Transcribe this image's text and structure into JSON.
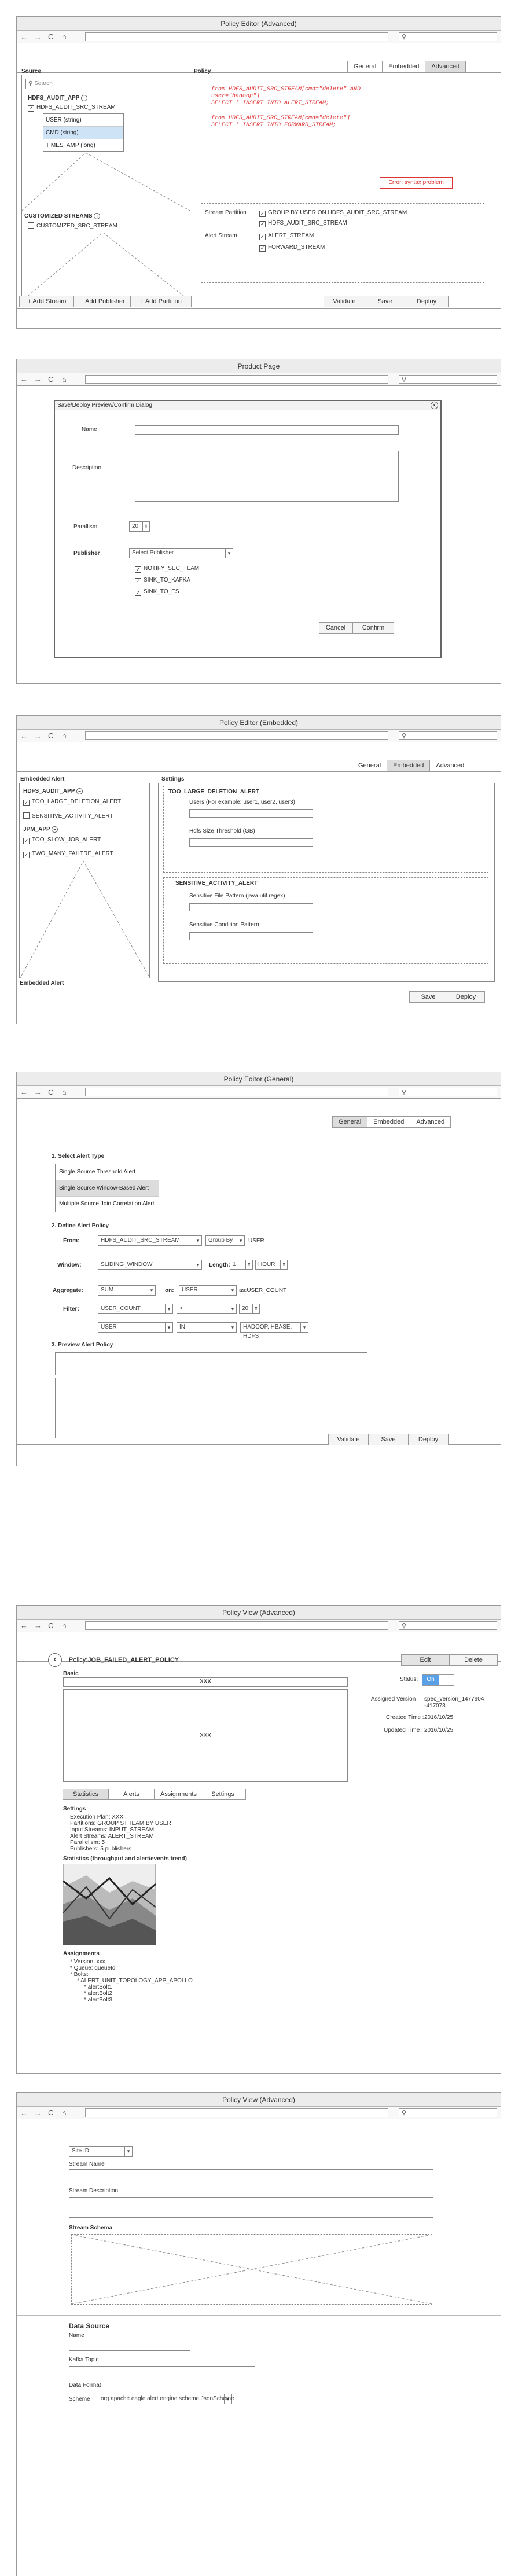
{
  "shared": {
    "nav": {
      "back": "←",
      "forward": "→",
      "reload": "C",
      "home": "⌂"
    },
    "search_icon": "⚲"
  },
  "w1": {
    "title": "Policy Editor (Advanced)",
    "tabs": [
      "General",
      "Embedded",
      "Advanced"
    ],
    "source_label": "Source",
    "policy_label": "Policy",
    "search_placeholder": "Search",
    "stream": "HDFS_AUDIT_APP",
    "stream_item": "HDFS_AUDIT_SRC_STREAM",
    "fields": [
      "USER (string)",
      "CMD (string)",
      "TIMESTAMP (long)"
    ],
    "custom_streams": "CUSTOMIZED STREAMS",
    "custom_item": "CUSTOMIZED_SRC_STREAM",
    "code": [
      "from HDFS_AUDIT_SRC_STREAM[cmd=\"delete\" AND",
      "user=\"hadoop\"]",
      "SELECT * INSERT INTO ALERT_STREAM;",
      "",
      "from HDFS_AUDIT_SRC_STREAM[cmd=\"delete\"]",
      "SELECT * INSERT INTO FORWARD_STREAM;"
    ],
    "error": "Error: syntax problem",
    "stream_partition": "Stream Partition",
    "alert_stream": "Alert Stream",
    "partitions": [
      "GROUP BY USER ON HDFS_AUDIT_SRC_STREAM",
      "HDFS_AUDIT_SRC_STREAM"
    ],
    "alert_streams": [
      "ALERT_STREAM",
      "FORWARD_STREAM"
    ],
    "buttons": [
      "+ Add Stream",
      "+ Add Publisher",
      "+ Add Partition"
    ],
    "actions": [
      "Validate",
      "Save",
      "Deploy"
    ]
  },
  "w2": {
    "title": "Product Page",
    "dialog_title": "Save/Deploy Preview/Confirm Dialog",
    "close": "✕",
    "name": "Name",
    "description": "Description",
    "parallism": "Parallism",
    "parallism_value": "20",
    "publisher": "Publisher",
    "publisher_placeholder": "Select Publisher",
    "publishers": [
      "NOTIFY_SEC_TEAM",
      "SINK_TO_KAFKA",
      "SINK_TO_ES"
    ],
    "cancel": "Cancel",
    "confirm": "Confirm"
  },
  "w3": {
    "title": "Policy Editor (Embedded)",
    "tabs": [
      "General",
      "Embedded",
      "Advanced"
    ],
    "embedded_alert": "Embedded Alert",
    "settings": "Settings",
    "app1": "HDFS_AUDIT_APP",
    "app1_items": [
      "TOO_LARGE_DELETION_ALERT",
      "SENSITIVE_ACTIVITY_ALERT"
    ],
    "app2": "JPM_APP",
    "app2_items": [
      "TOO_SLOW_JOB_ALERT",
      "TWO_MANY_FAILTRE_ALERT"
    ],
    "embedded_alert_bottom": "Embedded Alert",
    "s1_title": "TOO_LARGE_DELETION_ALERT",
    "s1_users": "Users (For example: user1, user2, user3)",
    "s1_threshold": "Hdfs Size Threshold (GB)",
    "s2_title": "SENSITIVE_ACTIVITY_ALERT",
    "s2_pattern": "Sensitive File Pattern (java.util.regex)",
    "s2_condition": "Sensitive Condition Pattern",
    "actions": [
      "Save",
      "Deploy"
    ]
  },
  "w4": {
    "title": "Policy Editor (General)",
    "tabs": [
      "General",
      "Embedded",
      "Advanced"
    ],
    "step1": "1. Select Alert Type",
    "types": [
      "Single Source Threshold Alert",
      "Single Source Window-Based Alert",
      "Multiple Source Join Correlation Alert"
    ],
    "step2": "2. Define Alert Policy",
    "from": "From:",
    "from_val": "HDFS_AUDIT_SRC_STREAM",
    "groupby": "Group By",
    "user": "USER",
    "window": "Window:",
    "window_val": "SLIDING_WINDOW",
    "length": "Length:",
    "length_val": "1",
    "hour": "HOUR",
    "aggregate": "Aggregate:",
    "agg_fn": "SUM",
    "on": "on:",
    "agg_field": "USER",
    "as": "as:USER_COUNT",
    "filter": "Filter:",
    "f1_field": "USER_COUNT",
    "f1_op": ">",
    "f1_val": "20",
    "f2_field": "USER",
    "f2_op": "IN",
    "f2_val": "HADOOP, HBASE, HDFS",
    "step3": "3. Preview Alert Policy",
    "actions": [
      "Validate",
      "Save",
      "Deploy"
    ]
  },
  "w5": {
    "title": "Policy View (Advanced)",
    "back": "‹",
    "policy_label": "Policy:",
    "policy_name": "JOB_FAILED_ALERT_POLICY",
    "edit": "Edit",
    "delete": "Delete",
    "basic": "Basic",
    "xxx1": "XXX",
    "xxx2": "XXX",
    "status": "Status:",
    "status_on": "On",
    "assigned_version": "Assigned Version :",
    "assigned_version_val": "spec_version_1477904 -417073",
    "created": "Created Time :",
    "created_val": "2016/10/25",
    "updated": "Updated Time :",
    "updated_val": "2016/10/25",
    "tabs": [
      "Statistics",
      "Alerts",
      "Assignments",
      "Settings"
    ],
    "settings": "Settings",
    "settings_lines": [
      "Execution Plan: XXX",
      "Partitions: GROUP STREAM BY USER",
      "Input Streams: INPUT_STREAM",
      "Alert Streams: ALERT_STREAM",
      "Parallelism: 5",
      "Publishers: 5 publishers"
    ],
    "statistics": "Statistics (throughput and alert/events trend)",
    "assignments": "Assignments",
    "assign_lines": [
      "* Version: xxx",
      "* Queue: queueId",
      "* Bolts:",
      "* ALERT_UNIT_TOPOLOGY_APP_APOLLO",
      "* alertBolt1",
      "* alertBolt2",
      "* alertBolt3"
    ]
  },
  "w6": {
    "title": "Policy View (Advanced)",
    "site": "Site ID",
    "stream_name": "Stream Name",
    "stream_desc": "Stream Description",
    "stream_schema": "Stream Schema",
    "data_source": "Data Source",
    "ds_name": "Name",
    "kafka": "Kafka Topic",
    "data_format": "Data Format",
    "scheme": "Scheme",
    "scheme_val": "org.apache.eagle.alert.engine.scheme.JsonScheme"
  }
}
